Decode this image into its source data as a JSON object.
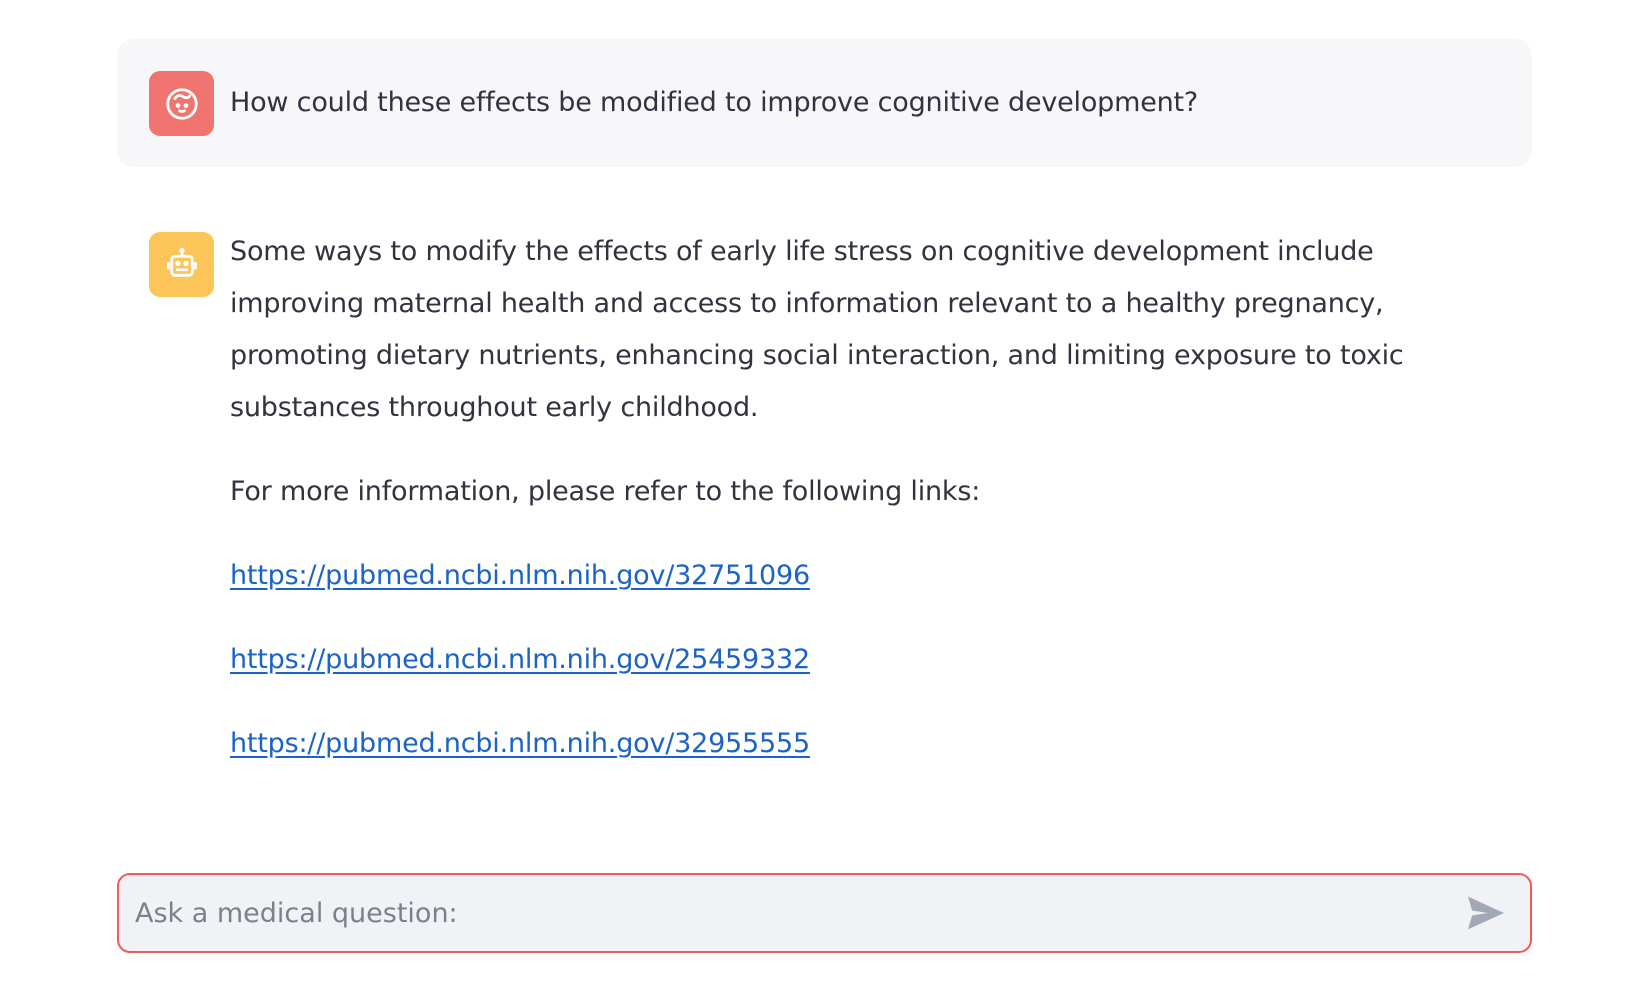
{
  "messages": {
    "user": {
      "avatar_icon": "smiley-face-icon",
      "avatar_color": "#f07470",
      "text": "How could these effects be modified to improve cognitive development?"
    },
    "assistant": {
      "avatar_icon": "robot-icon",
      "avatar_color": "#fbc55a",
      "paragraph": "Some ways to modify the effects of early life stress on cognitive development include improving maternal health and access to information relevant to a healthy pregnancy, promoting dietary nutrients, enhancing social interaction, and limiting exposure to toxic substances throughout early childhood.",
      "links_intro": "For more information, please refer to the following links:",
      "links": [
        "https://pubmed.ncbi.nlm.nih.gov/32751096",
        "https://pubmed.ncbi.nlm.nih.gov/25459332",
        "https://pubmed.ncbi.nlm.nih.gov/32955555"
      ]
    }
  },
  "chat_input": {
    "placeholder": "Ask a medical question:",
    "value": "",
    "border_color": "#f05a5a",
    "send_icon": "send-arrow-icon"
  }
}
